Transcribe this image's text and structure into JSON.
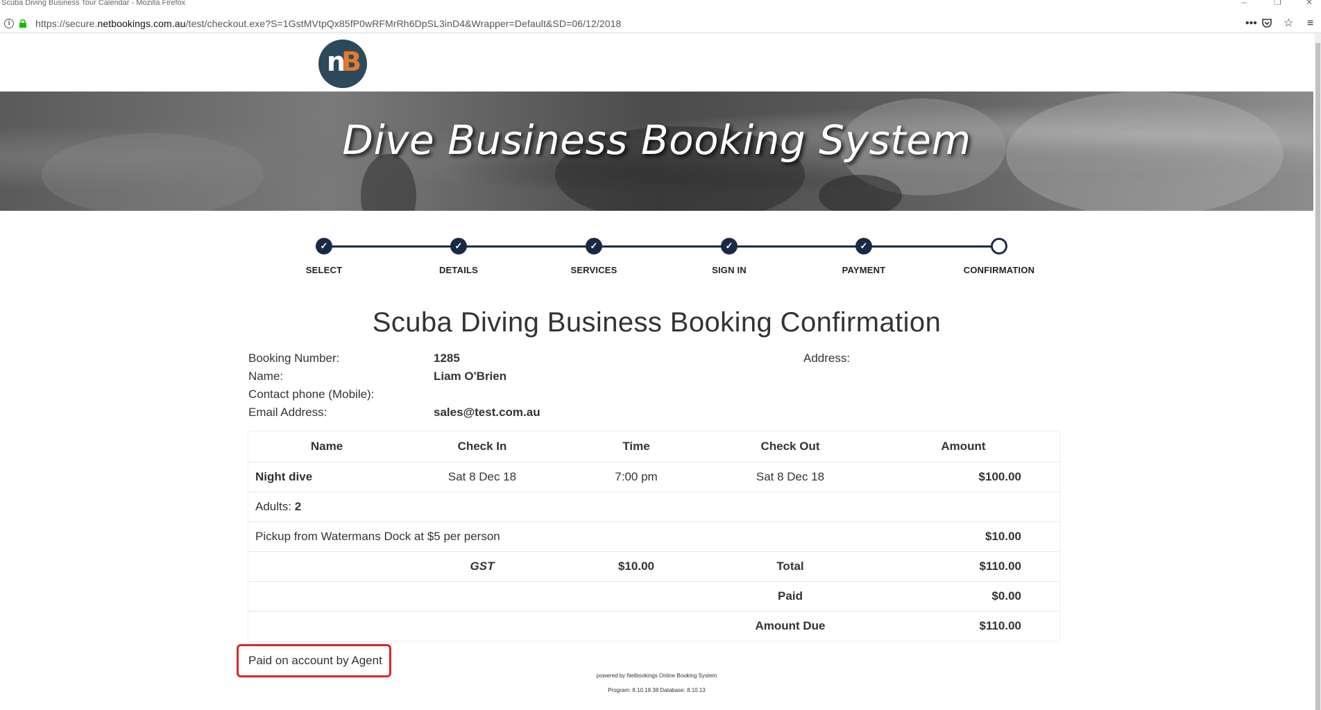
{
  "browser": {
    "window_title": "Scuba Diving Business Tour Calendar - Mozilla Firefox",
    "url_prefix": "https://secure.",
    "url_domain": "netbookings.com.au",
    "url_rest": "/test/checkout.exe?S=1GstMVtpQx85fP0wRFMrRh6DpSL3inD4&Wrapper=Default&SD=06/12/2018"
  },
  "header": {
    "logo_left": "n",
    "logo_right": "B",
    "banner_title": "Dive Business Booking System"
  },
  "steps": [
    {
      "label": "SELECT",
      "done": true
    },
    {
      "label": "DETAILS",
      "done": true
    },
    {
      "label": "SERVICES",
      "done": true
    },
    {
      "label": "SIGN IN",
      "done": true
    },
    {
      "label": "PAYMENT",
      "done": true
    },
    {
      "label": "CONFIRMATION",
      "done": false
    }
  ],
  "confirmation": {
    "title": "Scuba Diving Business Booking Confirmation",
    "booking_number_label": "Booking Number:",
    "booking_number": "1285",
    "name_label": "Name:",
    "name": "Liam O'Brien",
    "phone_label": "Contact phone (Mobile):",
    "email_label": "Email Address:",
    "email": "sales@test.com.au",
    "address_label": "Address:"
  },
  "table": {
    "headers": [
      "Name",
      "Check In",
      "Time",
      "Check Out",
      "Amount"
    ],
    "item": {
      "name": "Night dive",
      "check_in": "Sat 8 Dec 18",
      "time": "7:00 pm",
      "check_out": "Sat 8 Dec 18",
      "amount": "$100.00"
    },
    "adults_label": "Adults:",
    "adults": "2",
    "extra_label": "Pickup from Watermans Dock at $5 per person",
    "extra_amount": "$10.00",
    "gst_label": "GST",
    "gst_amount": "$10.00",
    "total_label": "Total",
    "total": "$110.00",
    "paid_label": "Paid",
    "paid": "$0.00",
    "due_label": "Amount Due",
    "due": "$110.00"
  },
  "payment_note": "Paid on account by Agent",
  "footer": {
    "powered_by": "powered by Netbookings Online Booking System",
    "version": "Program: 8.10.18.38 Database: 8.10.13"
  }
}
